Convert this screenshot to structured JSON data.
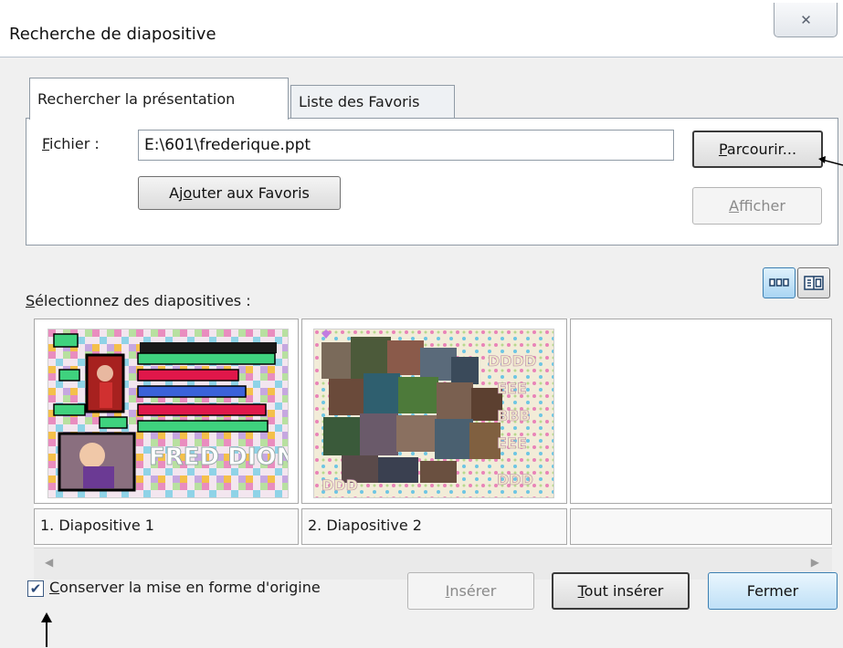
{
  "window": {
    "title": "Recherche de diapositive"
  },
  "tabs": [
    {
      "label": "Rechercher la présentation"
    },
    {
      "label": "Liste des Favoris"
    }
  ],
  "file": {
    "label_ul": "F",
    "label_rest": "ichier :",
    "value": "E:\\601\\frederique.ppt"
  },
  "buttons": {
    "browse": {
      "ul": "P",
      "rest": "arcourir..."
    },
    "add_fav": {
      "pre": "Aj",
      "ul": "o",
      "rest": "uter aux Favoris"
    },
    "show": {
      "ul": "A",
      "rest": "fficher"
    },
    "insert": {
      "ul": "I",
      "rest": "nsérer"
    },
    "insert_all": {
      "ul": "T",
      "rest": "out insérer"
    },
    "close": "Fermer"
  },
  "select_label": {
    "ul": "S",
    "rest": "électionnez des diapositives :"
  },
  "slides": [
    {
      "label": "1. Diapositive 1",
      "title_text": "FRED DIONNE"
    },
    {
      "label": "2. Diapositive 2"
    },
    {
      "label": ""
    }
  ],
  "keep_format": {
    "checked": true,
    "ul": "C",
    "rest": "onserver la mise en forme d'origine"
  },
  "colors": {
    "dialog_bg": "#f0f0f0",
    "accent": "#3c7fb1"
  }
}
